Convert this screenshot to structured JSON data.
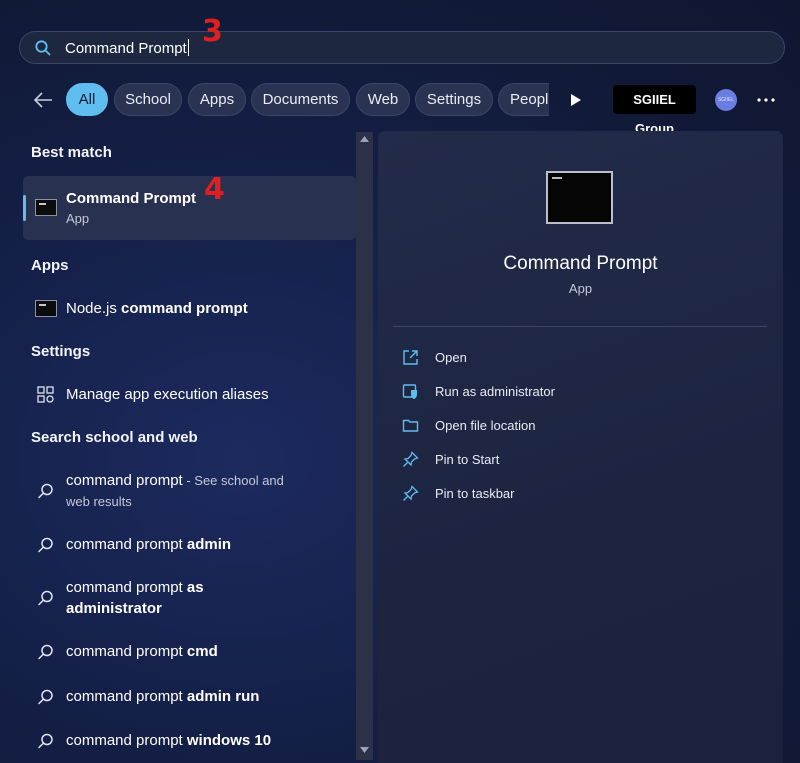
{
  "search": {
    "query": "Command Prompt",
    "annotation": "3"
  },
  "filters": {
    "tabs": [
      {
        "label": "All",
        "active": true
      },
      {
        "label": "School"
      },
      {
        "label": "Apps"
      },
      {
        "label": "Documents"
      },
      {
        "label": "Web"
      },
      {
        "label": "Settings"
      },
      {
        "label": "Peopl"
      }
    ],
    "org_label": "SGIIEL Group",
    "avatar_text": "SGIIEL"
  },
  "best_match": {
    "heading": "Best match",
    "title": "Command Prompt",
    "subtitle": "App",
    "annotation": "4"
  },
  "apps": {
    "heading": "Apps",
    "items": [
      {
        "prefix": "Node.js ",
        "bold": "command prompt"
      }
    ]
  },
  "settings": {
    "heading": "Settings",
    "items": [
      {
        "label": "Manage app execution aliases"
      }
    ]
  },
  "web": {
    "heading": "Search school and web",
    "items": [
      {
        "light": "command prompt",
        "hint": " - See school and web results"
      },
      {
        "light": "command prompt ",
        "bold": "admin"
      },
      {
        "light": "command prompt ",
        "bold": "as administrator"
      },
      {
        "light": "command prompt ",
        "bold": "cmd"
      },
      {
        "light": "command prompt ",
        "bold": "admin run"
      },
      {
        "light": "command prompt ",
        "bold": "windows 10"
      }
    ]
  },
  "details": {
    "title": "Command Prompt",
    "subtitle": "App",
    "actions": [
      {
        "label": "Open",
        "icon": "open-icon"
      },
      {
        "label": "Run as administrator",
        "icon": "admin-shield-icon"
      },
      {
        "label": "Open file location",
        "icon": "folder-icon"
      },
      {
        "label": "Pin to Start",
        "icon": "pin-icon"
      },
      {
        "label": "Pin to taskbar",
        "icon": "pin-icon"
      }
    ]
  },
  "colors": {
    "accent": "#5fbdf0",
    "annotation": "#e02020",
    "panel": "#1d2540"
  }
}
